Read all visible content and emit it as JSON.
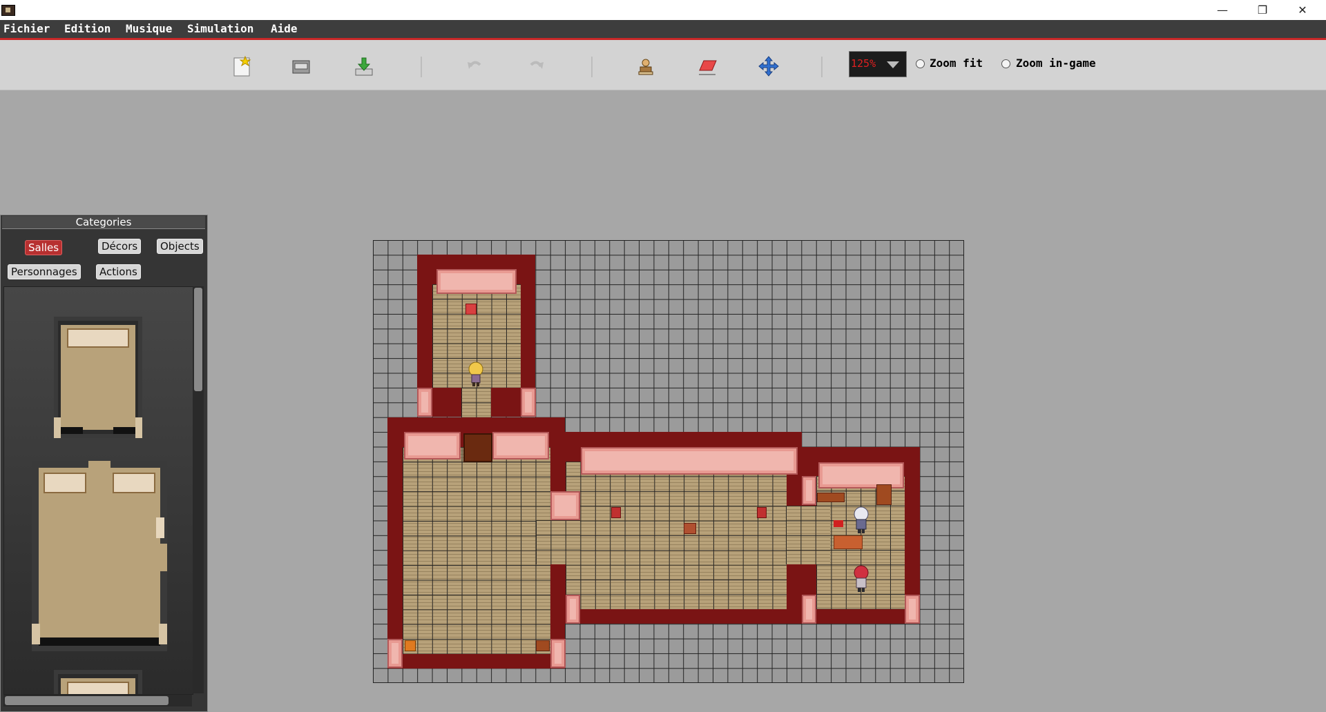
{
  "window": {
    "title": "",
    "controls": [
      "minimize",
      "restore",
      "close"
    ],
    "control_glyphs": {
      "minimize": "—",
      "restore": "❐",
      "close": "✕"
    }
  },
  "menubar": {
    "items": [
      "Fichier",
      "Edition",
      "Musique",
      "Simulation",
      "Aide"
    ]
  },
  "toolbar": {
    "buttons": [
      "new-file-icon",
      "open-file-icon",
      "save-icon",
      "undo-icon",
      "redo-icon",
      "character-stamp-icon",
      "eraser-icon",
      "move-icon"
    ],
    "zoom": {
      "value": "125%"
    },
    "zoom_fit_label": "Zoom fit",
    "zoom_ingame_label": "Zoom in-game"
  },
  "categories_panel": {
    "title": "Categories",
    "tabs": [
      "Salles",
      "Décors",
      "Objects",
      "Personnages",
      "Actions"
    ],
    "active_tab": "Salles"
  },
  "colors": {
    "menubar_bg": "#3d3d3d",
    "accent_red": "#c82828",
    "toolbar_bg": "#d3d3d3",
    "workspace_bg": "#a7a7a7",
    "wall_dark": "#7a1414",
    "wall_pink": "#e89a92",
    "floor": "#b8a27a",
    "zoom_text": "#e02020"
  }
}
